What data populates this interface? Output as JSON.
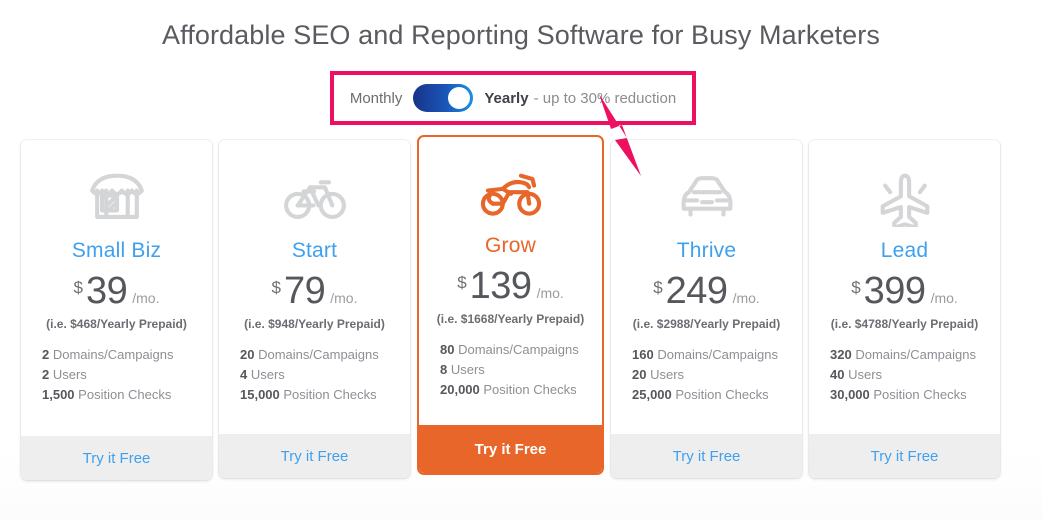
{
  "page": {
    "title": "Affordable SEO and Reporting Software for Busy Marketers"
  },
  "billing": {
    "monthly_label": "Monthly",
    "yearly_label": "Yearly",
    "discount_note": "- up to 30% reduction",
    "selected": "Yearly",
    "toggle_gradient_from": "#18338a",
    "toggle_gradient_to": "#1a91e8",
    "annotation_color": "#ee1060"
  },
  "colors": {
    "accent_blue": "#3fa0ee",
    "accent_orange": "#e8662a",
    "icon_gray": "#d4d5d7",
    "text_dark": "#55575c",
    "text_muted": "#8d8f94",
    "footer_bg": "#eeeeee"
  },
  "plans": [
    {
      "name": "Small Biz",
      "icon": "storefront-icon",
      "currency": "$",
      "price": "39",
      "period": "/mo.",
      "yearly_note": "(i.e. $468/Yearly Prepaid)",
      "features": [
        {
          "value": "2",
          "label": "Domains/Campaigns"
        },
        {
          "value": "2",
          "label": "Users"
        },
        {
          "value": "1,500",
          "label": "Position Checks"
        }
      ],
      "cta": "Try it Free",
      "featured": false
    },
    {
      "name": "Start",
      "icon": "bicycle-icon",
      "currency": "$",
      "price": "79",
      "period": "/mo.",
      "yearly_note": "(i.e. $948/Yearly Prepaid)",
      "features": [
        {
          "value": "20",
          "label": "Domains/Campaigns"
        },
        {
          "value": "4",
          "label": "Users"
        },
        {
          "value": "15,000",
          "label": "Position Checks"
        }
      ],
      "cta": "Try it Free",
      "featured": false
    },
    {
      "name": "Grow",
      "icon": "motorcycle-icon",
      "currency": "$",
      "price": "139",
      "period": "/mo.",
      "yearly_note": "(i.e. $1668/Yearly Prepaid)",
      "features": [
        {
          "value": "80",
          "label": "Domains/Campaigns"
        },
        {
          "value": "8",
          "label": "Users"
        },
        {
          "value": "20,000",
          "label": "Position Checks"
        }
      ],
      "cta": "Try it Free",
      "featured": true
    },
    {
      "name": "Thrive",
      "icon": "car-icon",
      "currency": "$",
      "price": "249",
      "period": "/mo.",
      "yearly_note": "(i.e. $2988/Yearly Prepaid)",
      "features": [
        {
          "value": "160",
          "label": "Domains/Campaigns"
        },
        {
          "value": "20",
          "label": "Users"
        },
        {
          "value": "25,000",
          "label": "Position Checks"
        }
      ],
      "cta": "Try it Free",
      "featured": false
    },
    {
      "name": "Lead",
      "icon": "airplane-icon",
      "currency": "$",
      "price": "399",
      "period": "/mo.",
      "yearly_note": "(i.e. $4788/Yearly Prepaid)",
      "features": [
        {
          "value": "320",
          "label": "Domains/Campaigns"
        },
        {
          "value": "40",
          "label": "Users"
        },
        {
          "value": "30,000",
          "label": "Position Checks"
        }
      ],
      "cta": "Try it Free",
      "featured": false
    }
  ]
}
